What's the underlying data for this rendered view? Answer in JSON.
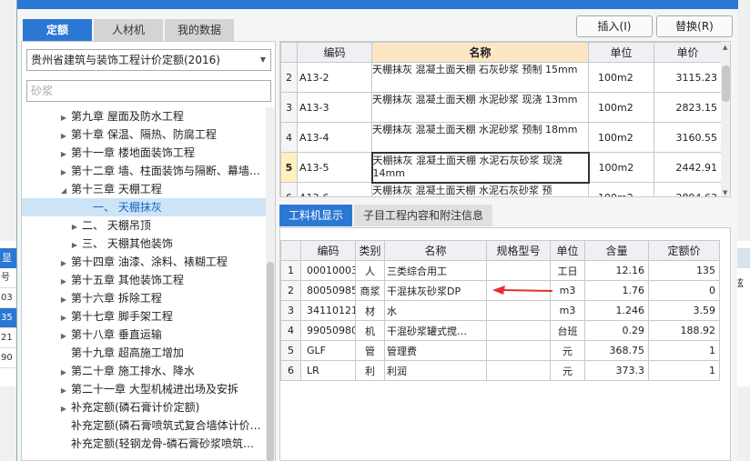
{
  "dialog": {
    "tabs": [
      "定额",
      "人材机",
      "我的数据"
    ],
    "buttons": {
      "insert": "插入(I)",
      "replace": "替换(R)"
    }
  },
  "left": {
    "select_value": "贵州省建筑与装饰工程计价定额(2016)",
    "search_value": "砂浆",
    "tree": [
      {
        "label": "第九章 屋面及防水工程",
        "toggle": "▶",
        "indent": 0,
        "selected": false
      },
      {
        "label": "第十章 保温、隔热、防腐工程",
        "toggle": "▶",
        "indent": 0,
        "selected": false
      },
      {
        "label": "第十一章 楼地面装饰工程",
        "toggle": "▶",
        "indent": 0,
        "selected": false
      },
      {
        "label": "第十二章 墙、柱面装饰与隔断、幕墙…",
        "toggle": "▶",
        "indent": 0,
        "selected": false
      },
      {
        "label": "第十三章 天棚工程",
        "toggle": "◢",
        "indent": 0,
        "selected": false
      },
      {
        "label": "一、 天棚抹灰",
        "toggle": "",
        "indent": 2,
        "selected": true
      },
      {
        "label": "二、 天棚吊顶",
        "toggle": "▶",
        "indent": 1,
        "selected": false
      },
      {
        "label": "三、 天棚其他装饰",
        "toggle": "▶",
        "indent": 1,
        "selected": false
      },
      {
        "label": "第十四章 油漆、涂料、裱糊工程",
        "toggle": "▶",
        "indent": 0,
        "selected": false
      },
      {
        "label": "第十五章 其他装饰工程",
        "toggle": "▶",
        "indent": 0,
        "selected": false
      },
      {
        "label": "第十六章 拆除工程",
        "toggle": "▶",
        "indent": 0,
        "selected": false
      },
      {
        "label": "第十七章 脚手架工程",
        "toggle": "▶",
        "indent": 0,
        "selected": false
      },
      {
        "label": "第十八章 垂直运输",
        "toggle": "▶",
        "indent": 0,
        "selected": false
      },
      {
        "label": "第十九章 超高施工增加",
        "toggle": "",
        "indent": 0,
        "selected": false
      },
      {
        "label": "第二十章 施工排水、降水",
        "toggle": "▶",
        "indent": 0,
        "selected": false
      },
      {
        "label": "第二十一章 大型机械进出场及安拆",
        "toggle": "▶",
        "indent": 0,
        "selected": false
      },
      {
        "label": "补充定额(磷石膏计价定额)",
        "toggle": "▶",
        "indent": 0,
        "selected": false
      },
      {
        "label": "补充定额(磷石膏喷筑式复合墙体计价…",
        "toggle": "",
        "indent": 0,
        "selected": false
      },
      {
        "label": "补充定额(轻钢龙骨-磷石膏砂浆喷筑…",
        "toggle": "",
        "indent": 0,
        "selected": false
      }
    ]
  },
  "quota_table": {
    "headers": [
      "",
      "编码",
      "名称",
      "单位",
      "单价"
    ],
    "rows": [
      {
        "idx": "2",
        "code": "A13-2",
        "name": "天棚抹灰 混凝土面天棚 石灰砂浆 预制 15mm",
        "unit": "100m2",
        "price": "3115.23",
        "current": false
      },
      {
        "idx": "3",
        "code": "A13-3",
        "name": "天棚抹灰 混凝土面天棚 水泥砂浆 现浇 13mm",
        "unit": "100m2",
        "price": "2823.15",
        "current": false
      },
      {
        "idx": "4",
        "code": "A13-4",
        "name": "天棚抹灰 混凝土面天棚 水泥砂浆 预制 18mm",
        "unit": "100m2",
        "price": "3160.55",
        "current": false
      },
      {
        "idx": "5",
        "code": "A13-5",
        "name": "天棚抹灰 混凝土面天棚 水泥石灰砂浆 现浇 14mm",
        "unit": "100m2",
        "price": "2442.91",
        "current": true
      },
      {
        "idx": "6",
        "code": "A13-6",
        "name": "天棚抹灰 混凝土面天棚 水泥石灰砂浆 预",
        "unit": "100m2",
        "price": "2894.63",
        "current": false
      }
    ]
  },
  "bottom_tabs": [
    "工料机显示",
    "子目工程内容和附注信息"
  ],
  "material_table": {
    "headers": [
      "",
      "编码",
      "类别",
      "名称",
      "规格型号",
      "单位",
      "含量",
      "定额价"
    ],
    "rows": [
      {
        "idx": "1",
        "code": "00010003",
        "type": "人",
        "name": "三类综合用工",
        "spec": "",
        "unit": "工日",
        "qty": "12.16",
        "price": "135"
      },
      {
        "idx": "2",
        "code": "80050985",
        "type": "商浆",
        "name": "干混抹灰砂浆DP",
        "spec": "",
        "unit": "m3",
        "qty": "1.76",
        "price": "0"
      },
      {
        "idx": "3",
        "code": "34110121",
        "type": "材",
        "name": "水",
        "spec": "",
        "unit": "m3",
        "qty": "1.246",
        "price": "3.59"
      },
      {
        "idx": "4",
        "code": "99050980",
        "type": "机",
        "name": "干混砂浆罐式搅…",
        "spec": "",
        "unit": "台班",
        "qty": "0.29",
        "price": "188.92"
      },
      {
        "idx": "5",
        "code": "GLF",
        "type": "管",
        "name": "管理费",
        "spec": "",
        "unit": "元",
        "qty": "368.75",
        "price": "1"
      },
      {
        "idx": "6",
        "code": "LR",
        "type": "利",
        "name": "利润",
        "spec": "",
        "unit": "元",
        "qty": "373.3",
        "price": "1"
      }
    ]
  },
  "background": {
    "left_header": "显示",
    "left_cells": [
      "号",
      "03",
      "35",
      "21",
      "90"
    ],
    "right_cells": [
      "炫"
    ]
  },
  "colors": {
    "accent": "#2b78d4",
    "annotation_arrow": "#e53030",
    "name_header": "#fde6c4"
  }
}
